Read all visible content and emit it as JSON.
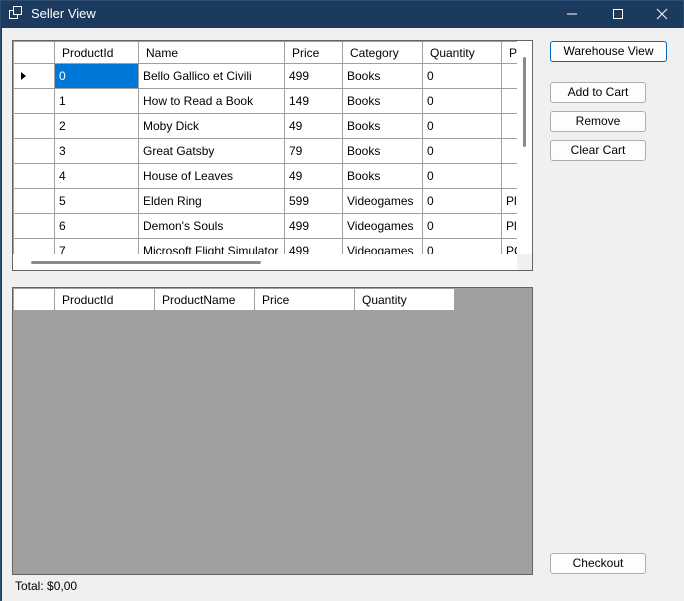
{
  "window": {
    "title": "Seller View",
    "icon": "window-app-icon",
    "controls": [
      "minimize-icon",
      "maximize-icon",
      "close-icon"
    ]
  },
  "products_grid": {
    "columns": [
      "ProductId",
      "Name",
      "Price",
      "Category",
      "Quantity",
      "P"
    ],
    "rows": [
      {
        "id": "0",
        "name": "Bello Gallico et Civili",
        "price": "499",
        "category": "Books",
        "quantity": "0",
        "p": ""
      },
      {
        "id": "1",
        "name": "How to Read a Book",
        "price": "149",
        "category": "Books",
        "quantity": "0",
        "p": ""
      },
      {
        "id": "2",
        "name": "Moby Dick",
        "price": "49",
        "category": "Books",
        "quantity": "0",
        "p": ""
      },
      {
        "id": "3",
        "name": "Great Gatsby",
        "price": "79",
        "category": "Books",
        "quantity": "0",
        "p": ""
      },
      {
        "id": "4",
        "name": "House of Leaves",
        "price": "49",
        "category": "Books",
        "quantity": "0",
        "p": ""
      },
      {
        "id": "5",
        "name": "Elden Ring",
        "price": "599",
        "category": "Videogames",
        "quantity": "0",
        "p": "Pl"
      },
      {
        "id": "6",
        "name": "Demon's Souls",
        "price": "499",
        "category": "Videogames",
        "quantity": "0",
        "p": "Pl"
      },
      {
        "id": "7",
        "name": "Microsoft Flight Simulator",
        "price": "499",
        "category": "Videogames",
        "quantity": "0",
        "p": "PC"
      }
    ],
    "selected_row": 0
  },
  "cart_grid": {
    "columns": [
      "ProductId",
      "ProductName",
      "Price",
      "Quantity"
    ]
  },
  "buttons": {
    "warehouse_view": "Warehouse View",
    "add_to_cart": "Add to Cart",
    "remove": "Remove",
    "clear_cart": "Clear Cart",
    "checkout": "Checkout"
  },
  "total_label": "Total: $0,00",
  "colors": {
    "titlebar": "#1b3a5e",
    "selection": "#0078d7",
    "cart_background": "#a0a0a0"
  }
}
